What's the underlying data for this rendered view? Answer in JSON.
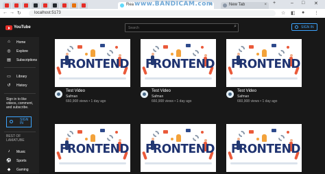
{
  "browser": {
    "tabs": [
      {
        "favicon_color": "#e52d27"
      },
      {
        "favicon_color": "#e52d27"
      },
      {
        "favicon_color": "#e52d27"
      },
      {
        "favicon_color": "#24292e"
      },
      {
        "favicon_color": "#e52d27"
      },
      {
        "favicon_color": "#24292e"
      },
      {
        "favicon_color": "#e52d27"
      },
      {
        "favicon_color": "#e8710a"
      },
      {
        "favicon_color": "#e52d27"
      }
    ],
    "active_tab": {
      "title": "Rea",
      "close": "×"
    },
    "new_tab": {
      "title": "New Tab",
      "close": "×"
    },
    "url": "localhost:5173",
    "watermark": "www.BANDICAM.com"
  },
  "app": {
    "logo_text": "YouTube",
    "search_placeholder": "Search",
    "sign_in_label": "SIGN IN",
    "sidebar": {
      "items": [
        {
          "icon": "home-icon",
          "glyph": "⌂",
          "label": "Home"
        },
        {
          "icon": "explore-icon",
          "glyph": "◎",
          "label": "Explore"
        },
        {
          "icon": "subscriptions-icon",
          "glyph": "▤",
          "label": "Subscriptions"
        },
        {
          "icon": "library-icon",
          "glyph": "▭",
          "label": "Library"
        },
        {
          "icon": "history-icon",
          "glyph": "↺",
          "label": "History"
        }
      ],
      "signin_prompt": "Sign in to like videos, comment, and subscribe.",
      "signin_button": "SIGN IN",
      "section_title": "BEST OF LAMATUBE",
      "categories": [
        {
          "icon": "music-icon",
          "glyph": "♪",
          "label": "Music"
        },
        {
          "icon": "sports-icon",
          "glyph": "⚽",
          "label": "Sports"
        },
        {
          "icon": "gaming-icon",
          "glyph": "◆",
          "label": "Gaming"
        }
      ]
    },
    "videos": [
      {
        "title": "Test Video",
        "channel": "Safman",
        "meta": "660,908 views • 1 day ago",
        "thumb_text": "FRONTEND"
      },
      {
        "title": "Test Video",
        "channel": "Safman",
        "meta": "660,908 views • 1 day ago",
        "thumb_text": "FRONTEND"
      },
      {
        "title": "Test Video",
        "channel": "Safman",
        "meta": "660,908 views • 1 day ago",
        "thumb_text": "FRONTEND"
      },
      {
        "title": "",
        "channel": "",
        "meta": "",
        "thumb_text": "FRONTEND"
      },
      {
        "title": "",
        "channel": "",
        "meta": "",
        "thumb_text": "FRONTEND"
      },
      {
        "title": "",
        "channel": "",
        "meta": "",
        "thumb_text": "FRONTEND"
      }
    ],
    "colors": {
      "accent": "#3ea6ff",
      "background": "#181818",
      "sidebar": "#212121",
      "brand": "#e52d27"
    }
  }
}
